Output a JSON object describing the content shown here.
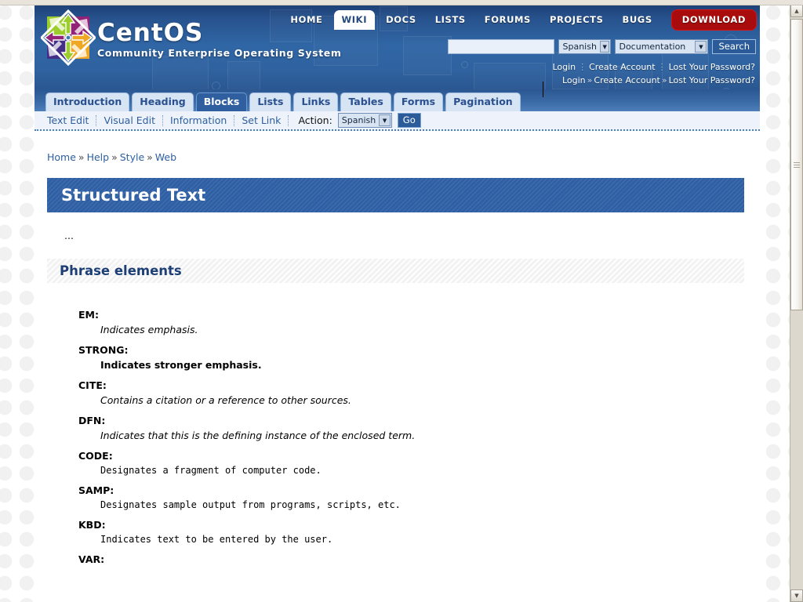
{
  "header": {
    "brand_name": "CentOS",
    "brand_tagline": "Community Enterprise Operating System",
    "logo_icon": "centos-logo-icon",
    "nav": [
      {
        "label": "HOME",
        "active": false
      },
      {
        "label": "WIKI",
        "active": true
      },
      {
        "label": "DOCS",
        "active": false
      },
      {
        "label": "LISTS",
        "active": false
      },
      {
        "label": "FORUMS",
        "active": false
      },
      {
        "label": "PROJECTS",
        "active": false
      },
      {
        "label": "BUGS",
        "active": false
      }
    ],
    "download_label": "DOWNLOAD",
    "search": {
      "value": "",
      "placeholder": "",
      "language_selected": "Spanish",
      "scope_selected": "Documentation",
      "button_label": "Search",
      "dropdown_icon": "chevron-down-icon"
    },
    "account_row_1": {
      "login": "Login",
      "create_account": "Create Account",
      "lost_password": "Lost Your Password?"
    },
    "account_row_2": {
      "login": "Login",
      "sep": "»",
      "create_account": "Create Account",
      "lost_password": "Lost Your Password?"
    }
  },
  "tabs": [
    {
      "label": "Introduction",
      "active": false
    },
    {
      "label": "Heading",
      "active": false
    },
    {
      "label": "Blocks",
      "active": true
    },
    {
      "label": "Lists",
      "active": false
    },
    {
      "label": "Links",
      "active": false
    },
    {
      "label": "Tables",
      "active": false
    },
    {
      "label": "Forms",
      "active": false
    },
    {
      "label": "Pagination",
      "active": false
    }
  ],
  "actionbar": {
    "links": [
      "Text Edit",
      "Visual Edit",
      "Information",
      "Set Link"
    ],
    "action_label": "Action:",
    "action_selected": "Spanish",
    "go_label": "Go",
    "dropdown_icon": "chevron-down-icon"
  },
  "breadcrumb": {
    "items": [
      "Home",
      "Help",
      "Style",
      "Web"
    ],
    "separator": "»"
  },
  "main": {
    "page_title": "Structured Text",
    "intro_text": "...",
    "section_heading": "Phrase elements",
    "definitions": [
      {
        "term": "EM:",
        "desc": "Indicates emphasis.",
        "style": "em"
      },
      {
        "term": "STRONG:",
        "desc": "Indicates stronger emphasis.",
        "style": "strong"
      },
      {
        "term": "CITE:",
        "desc": "Contains a citation or a reference to other sources.",
        "style": "em"
      },
      {
        "term": "DFN:",
        "desc": "Indicates that this is the defining instance of the enclosed term.",
        "style": "em"
      },
      {
        "term": "CODE:",
        "desc": "Designates a fragment of computer code.",
        "style": "mono"
      },
      {
        "term": "SAMP:",
        "desc": "Designates sample output from programs, scripts, etc.",
        "style": "mono"
      },
      {
        "term": "KBD:",
        "desc": "Indicates text to be entered by the user.",
        "style": "mono"
      },
      {
        "term": "VAR:",
        "desc": "",
        "style": "em"
      }
    ]
  },
  "scrollbar": {
    "up_icon": "scroll-up-arrow-icon",
    "down_icon": "scroll-down-arrow-icon",
    "thumb_icon": "scrollbar-thumb-grip-icon"
  },
  "colors": {
    "header_blue": "#3066a5",
    "dark_blue": "#1d3f76",
    "tab_active": "#2f5f9e",
    "tab_inactive": "#d6e4f4",
    "download_red": "#a80c0c",
    "link_blue": "#2d5fa0",
    "title_bar_blue": "#2f5fa4",
    "section_gray": "#f2f2f2"
  }
}
